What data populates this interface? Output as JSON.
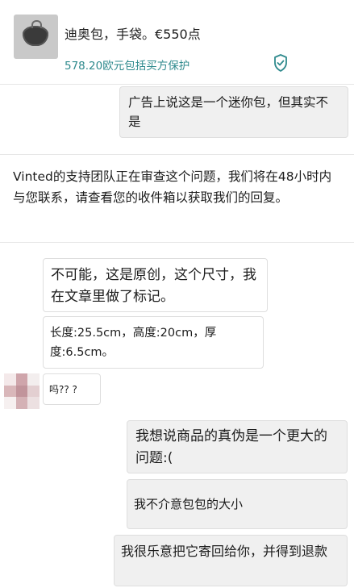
{
  "header": {
    "item_title": "迪奥包，手袋。€550点",
    "price_protection": "578.20欧元包括买方保护",
    "icons": {
      "thumbnail": "bag-thumbnail",
      "shield": "shield-check-icon"
    },
    "accent_color": "#2f8a8d"
  },
  "messages": {
    "m1": "广告上说这是一个迷你包，但其实不是",
    "notice": "Vinted的支持团队正在审查这个问题，我们将在48小时内与您联系，请查看您的收件箱以获取我们的回复。",
    "m2": "不可能，这是原创，这个尺寸，我在文章里做了标记。",
    "m3": "长度:25.5cm，高度:20cm，厚度:6.5cm。",
    "m4": "吗?? ?",
    "m5": "我想说商品的真伪是一个更大的问题:(",
    "m6": "我不介意包包的大小",
    "m7": "我很乐意把它寄回给你，并得到退款"
  }
}
